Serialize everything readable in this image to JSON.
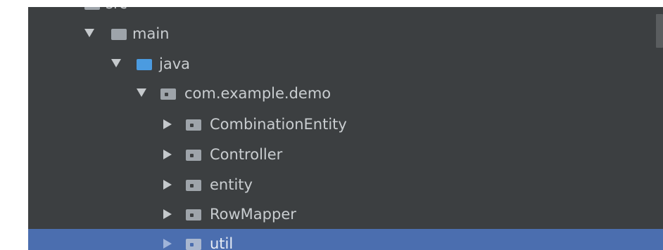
{
  "tree": {
    "items": [
      {
        "label": "src"
      },
      {
        "label": "main"
      },
      {
        "label": "java"
      },
      {
        "label": "com.example.demo"
      },
      {
        "label": "CombinationEntity"
      },
      {
        "label": "Controller"
      },
      {
        "label": "entity"
      },
      {
        "label": "RowMapper"
      },
      {
        "label": "util"
      }
    ]
  },
  "colors": {
    "panel_bg": "#3c3f41",
    "selection": "#4b6eaf",
    "source_root_folder": "#4b9be0",
    "folder": "#9ea4aa",
    "text": "#c9cdd0"
  }
}
